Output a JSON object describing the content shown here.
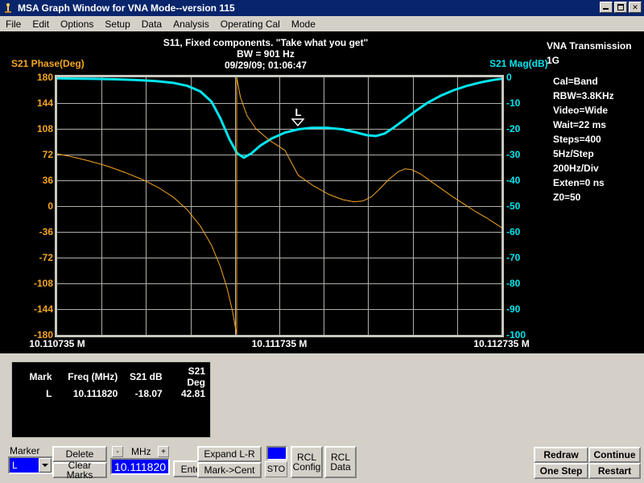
{
  "window": {
    "title": "MSA Graph Window for VNA Mode--version 115",
    "icon": "pin-icon",
    "buttons": {
      "minimize": "minimize-icon",
      "maximize": "maximize-icon",
      "close": "close-icon"
    }
  },
  "menu": {
    "items": [
      "File",
      "Edit",
      "Options",
      "Setup",
      "Data",
      "Analysis",
      "Operating Cal",
      "Mode"
    ]
  },
  "chart_title": {
    "line1": "S11, Fixed components. \"Take what you get\"",
    "line2": "BW = 901 Hz",
    "line3": "09/29/09; 01:06:47"
  },
  "info": {
    "heading1": "VNA Transmission",
    "heading2": "1G",
    "items": [
      "Cal=Band",
      "RBW=3.8KHz",
      "Video=Wide",
      "Wait=22 ms",
      "Steps=400",
      "5Hz/Step",
      "200Hz/Div",
      "Exten=0 ns",
      "Z0=50"
    ]
  },
  "chart_data": {
    "type": "line",
    "title": "S11, Fixed components. \"Take what you get\"",
    "subtitle": "BW = 901 Hz",
    "timestamp": "09/29/09; 01:06:47",
    "xlabel": "",
    "grid": true,
    "legend": "none",
    "x_unit": "MHz",
    "xlim": [
      10.110735,
      10.112735
    ],
    "x_ticks": [
      "10.110735 M",
      "10.111735 M",
      "10.112735 M"
    ],
    "x_tick_values": [
      10.110735,
      10.111735,
      10.112735
    ],
    "x_gridlines": 10,
    "y_gridlines": 10,
    "axes": [
      {
        "id": "left",
        "label": "S21 Phase(Deg)",
        "color": "#f5a623",
        "ylim": [
          -180,
          180
        ],
        "ticks": [
          180,
          144,
          108,
          72,
          36,
          0,
          -36,
          -72,
          -108,
          -144,
          -180
        ]
      },
      {
        "id": "right",
        "label": "S21 Mag(dB)",
        "color": "#00e5ee",
        "ylim": [
          -100,
          0
        ],
        "ticks": [
          0,
          -10,
          -20,
          -30,
          -40,
          -50,
          -60,
          -70,
          -80,
          -90,
          -100
        ]
      }
    ],
    "series": [
      {
        "name": "S21 Mag(dB)",
        "axis": "right",
        "color": "#00e5ee",
        "width": 3,
        "points": [
          [
            10.110735,
            -0.4
          ],
          [
            10.1108,
            -0.5
          ],
          [
            10.1109,
            -0.6
          ],
          [
            10.111,
            -0.8
          ],
          [
            10.1111,
            -1.1
          ],
          [
            10.11118,
            -1.5
          ],
          [
            10.11126,
            -2.2
          ],
          [
            10.11132,
            -3.3
          ],
          [
            10.11138,
            -5.5
          ],
          [
            10.11143,
            -9.5
          ],
          [
            10.11147,
            -16.0
          ],
          [
            10.11151,
            -24.0
          ],
          [
            10.111545,
            -29.5
          ],
          [
            10.111575,
            -31.2
          ],
          [
            10.11161,
            -29.5
          ],
          [
            10.11165,
            -26.5
          ],
          [
            10.1117,
            -23.8
          ],
          [
            10.11176,
            -21.5
          ],
          [
            10.11182,
            -20.2
          ],
          [
            10.11188,
            -19.6
          ],
          [
            10.11195,
            -19.6
          ],
          [
            10.11202,
            -20.2
          ],
          [
            10.11208,
            -21.4
          ],
          [
            10.11213,
            -22.5
          ],
          [
            10.11217,
            -22.8
          ],
          [
            10.11221,
            -21.8
          ],
          [
            10.11225,
            -19.5
          ],
          [
            10.1123,
            -16.3
          ],
          [
            10.11235,
            -13.0
          ],
          [
            10.1124,
            -10.0
          ],
          [
            10.11246,
            -7.2
          ],
          [
            10.11252,
            -5.0
          ],
          [
            10.11258,
            -3.3
          ],
          [
            10.11264,
            -2.0
          ],
          [
            10.1127,
            -1.0
          ],
          [
            10.112735,
            -0.6
          ]
        ]
      },
      {
        "name": "S21 Phase(Deg)",
        "axis": "left",
        "color": "#f5a623",
        "width": 1,
        "segments": [
          [
            [
              10.110735,
              73
            ],
            [
              10.1108,
              69
            ],
            [
              10.11088,
              63
            ],
            [
              10.11096,
              56
            ],
            [
              10.11104,
              47
            ],
            [
              10.11112,
              37
            ],
            [
              10.11119,
              26
            ],
            [
              10.11126,
              12
            ],
            [
              10.11132,
              -5
            ],
            [
              10.11138,
              -28
            ],
            [
              10.11143,
              -55
            ],
            [
              10.11147,
              -85
            ],
            [
              10.1115,
              -115
            ],
            [
              10.111525,
              -148
            ],
            [
              10.111543,
              -180
            ]
          ],
          [
            [
              10.111543,
              180
            ],
            [
              10.11156,
              152
            ],
            [
              10.11159,
              126
            ],
            [
              10.11163,
              108
            ],
            [
              10.11169,
              92
            ],
            [
              10.11176,
              78
            ],
            [
              10.11182,
              43
            ],
            [
              10.11183,
              41
            ],
            [
              10.11189,
              28
            ],
            [
              10.11196,
              16
            ],
            [
              10.11202,
              9
            ],
            [
              10.11207,
              6
            ],
            [
              10.11211,
              7
            ],
            [
              10.11215,
              13
            ],
            [
              10.11219,
              25
            ],
            [
              10.11223,
              38
            ],
            [
              10.11227,
              48
            ],
            [
              10.1123,
              52
            ],
            [
              10.11233,
              51
            ],
            [
              10.11237,
              45
            ],
            [
              10.11242,
              34
            ],
            [
              10.11247,
              23
            ],
            [
              10.11252,
              12
            ],
            [
              10.11257,
              2
            ],
            [
              10.11262,
              -8
            ],
            [
              10.11267,
              -17
            ],
            [
              10.11271,
              -25
            ],
            [
              10.112735,
              -30
            ]
          ]
        ]
      }
    ],
    "markers": [
      {
        "id": "L",
        "label": "L",
        "freq_mhz": 10.11182,
        "mag_db": -18.07,
        "phase_deg": 42.81
      }
    ]
  },
  "marker_table": {
    "headers": [
      "Mark",
      "Freq (MHz)",
      "S21 dB",
      "S21 Deg"
    ],
    "rows": [
      {
        "mark": "L",
        "freq": "10.111820",
        "db": "-18.07",
        "deg": "42.81"
      }
    ]
  },
  "controls": {
    "marker_label": "Marker",
    "marker_value": "L",
    "delete_label": "Delete",
    "clear_marks_label": "Clear Marks",
    "minus_label": "-",
    "plus_label": "+",
    "mhz_label": "MHz",
    "freq_value": "10.111820",
    "enter_label": "Enter",
    "expand_label": "Expand L-R",
    "mark_cent_label": "Mark->Cent",
    "sto_label": "STO",
    "rcl_config_line1": "RCL",
    "rcl_config_line2": "Config",
    "rcl_data_line1": "RCL",
    "rcl_data_line2": "Data",
    "redraw_label": "Redraw",
    "continue_label": "Continue",
    "one_step_label": "One Step",
    "restart_label": "Restart",
    "sto_led_color": "#0000ff"
  }
}
